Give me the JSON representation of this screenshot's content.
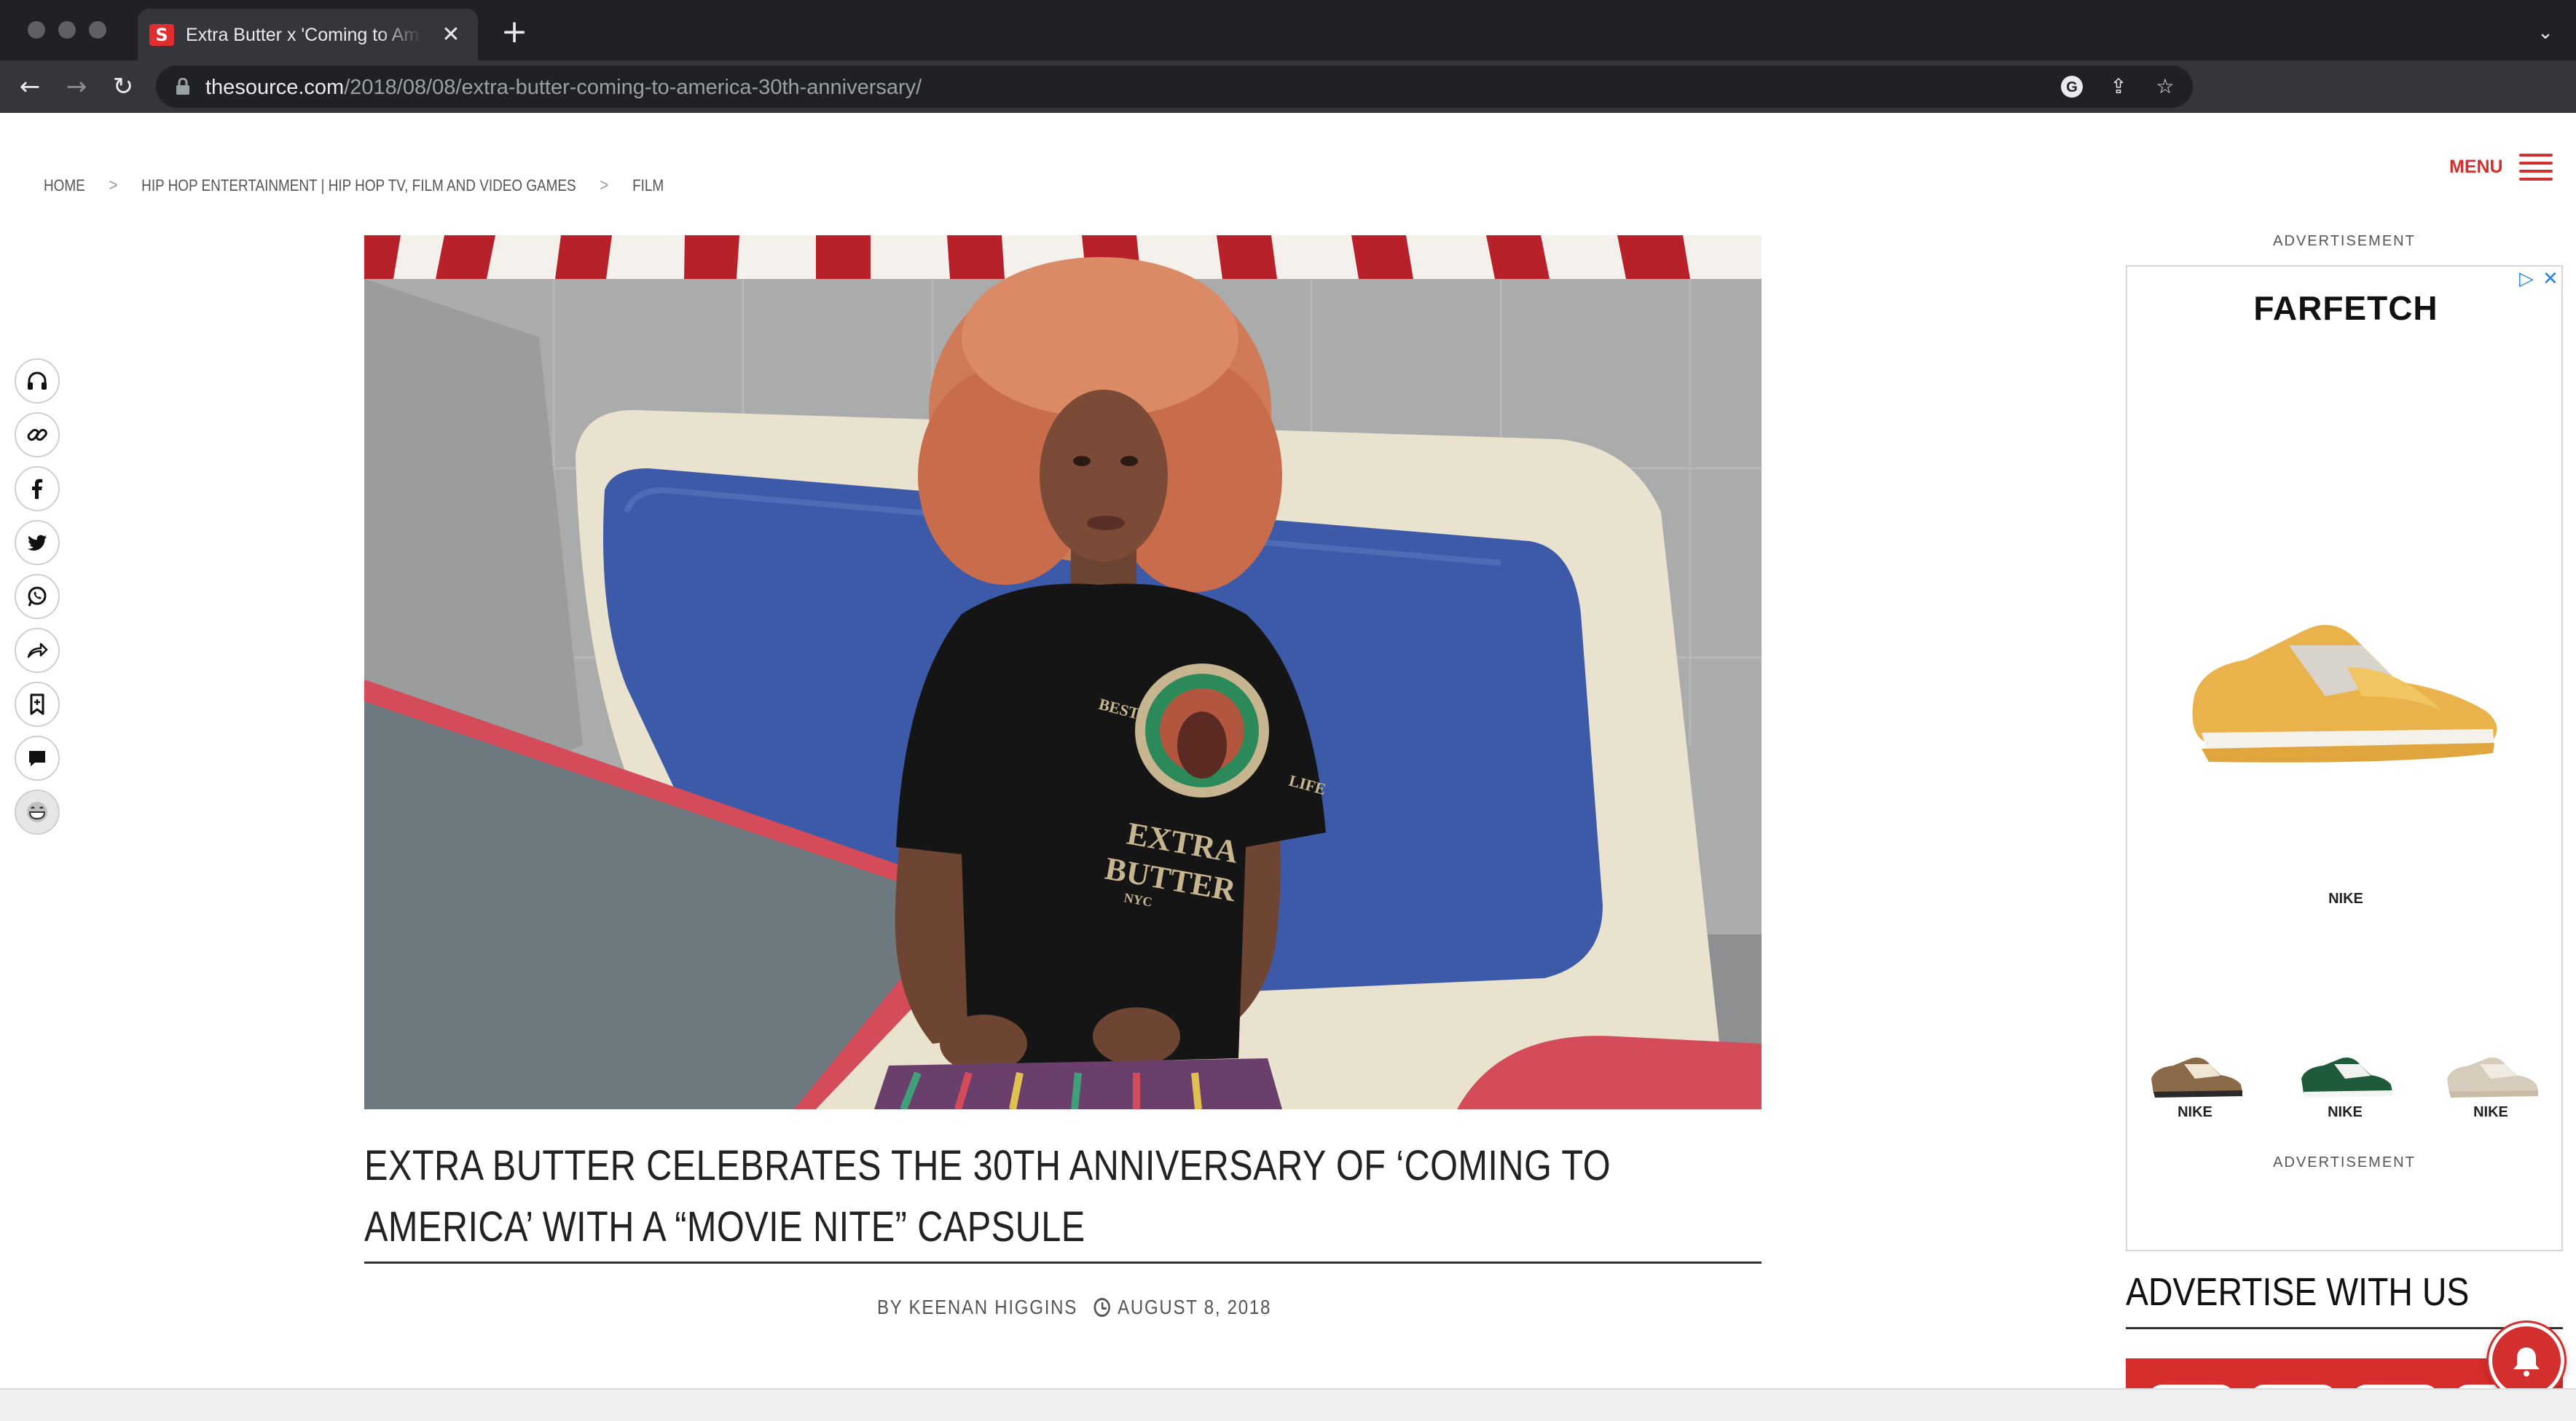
{
  "browser": {
    "tab_title": "Extra Butter x 'Coming to America",
    "tab_favicon": "S",
    "url_host": "thesource.com",
    "url_path": "/2018/08/08/extra-butter-coming-to-america-30th-anniversary/",
    "icons": [
      "back-icon",
      "forward-icon",
      "reload-icon",
      "lock-icon",
      "google-icon",
      "share-icon",
      "star-icon",
      "new-tab-icon",
      "tab-close-icon",
      "tab-list-icon"
    ]
  },
  "breadcrumb": {
    "home": "HOME",
    "category": "HIP HOP ENTERTAINMENT | HIP HOP TV, FILM AND VIDEO GAMES",
    "sub": "FILM",
    "separator": ">"
  },
  "menu": {
    "label": "MENU"
  },
  "share_rail": [
    "headphones-icon",
    "link-icon",
    "facebook-icon",
    "twitter-icon",
    "whatsapp-icon",
    "share-arrow-icon",
    "bookmark-icon",
    "comment-icon",
    "emoji-icon"
  ],
  "hero": {
    "shirt_text_top": "BEST",
    "shirt_text_right": "LIFE",
    "shirt_text_main_1": "EXTRA",
    "shirt_text_main_2": "BUTTER",
    "shirt_text_city": "NYC"
  },
  "article": {
    "title": "EXTRA BUTTER CELEBRATES THE 30TH ANNIVERSARY OF ‘COMING TO AMERICA’ WITH A “MOVIE NITE” CAPSULE",
    "author": "BY KEENAN HIGGINS",
    "date": "AUGUST 8, 2018"
  },
  "sidebar": {
    "ad_label_top": "ADVERTISEMENT",
    "ad_label_bottom": "ADVERTISEMENT",
    "ad_brand": "FARFETCH",
    "ad_main_label": "NIKE",
    "ad_items": [
      "NIKE",
      "NIKE",
      "NIKE"
    ],
    "advertise_heading": "ADVERTISE WITH US"
  },
  "colors": {
    "accent": "#d32f2f",
    "chrome_dark": "#202124",
    "chrome_mid": "#35363a",
    "ad_blue": "#2b83e6"
  }
}
